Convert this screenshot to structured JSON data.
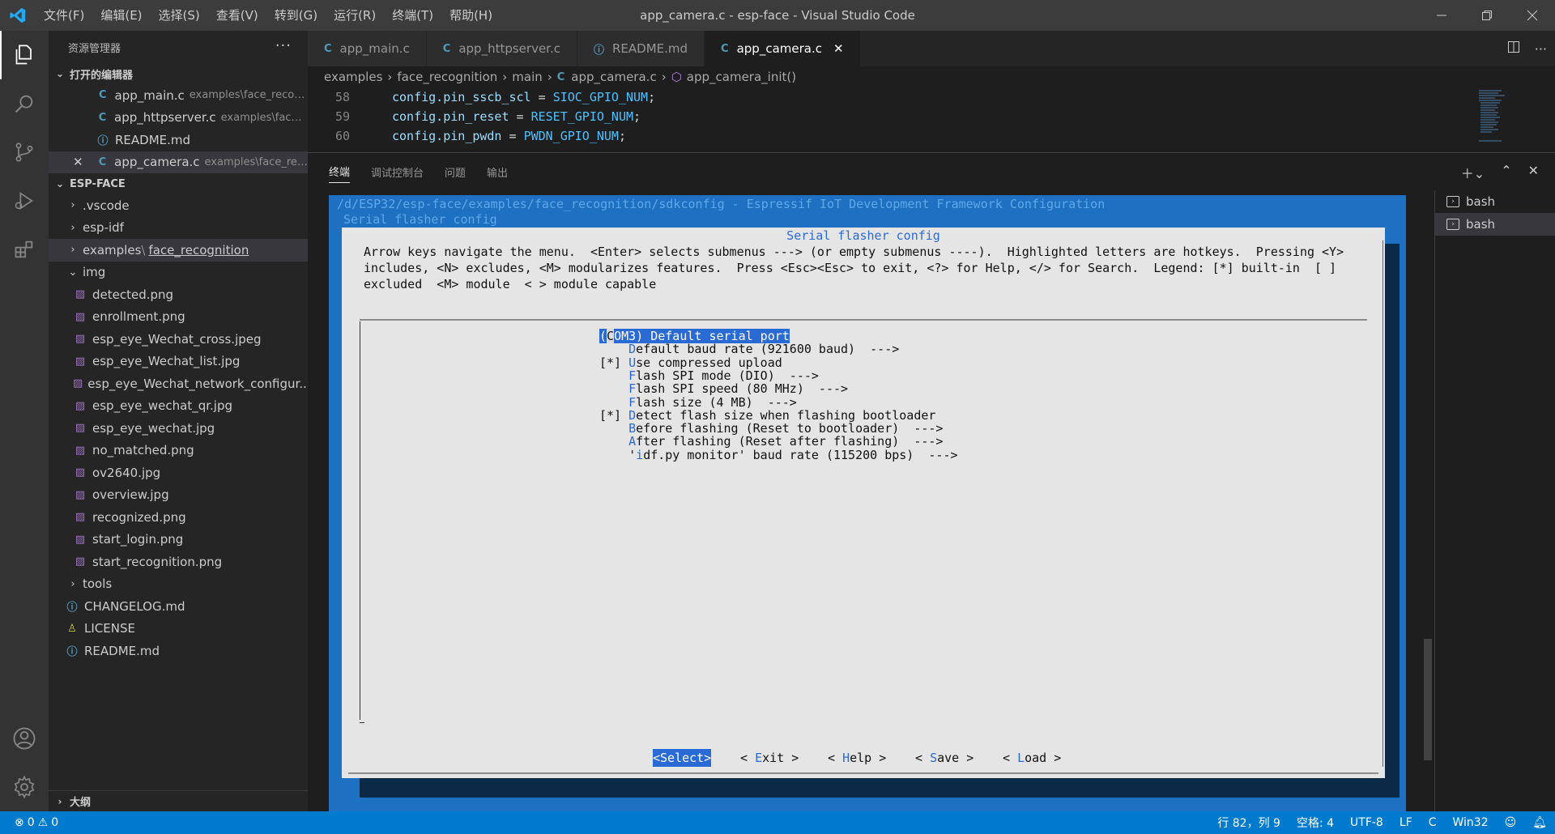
{
  "window": {
    "title": "app_camera.c - esp-face - Visual Studio Code",
    "menu": [
      "文件(F)",
      "编辑(E)",
      "选择(S)",
      "查看(V)",
      "转到(G)",
      "运行(R)",
      "终端(T)",
      "帮助(H)"
    ]
  },
  "sidebar": {
    "header": "资源管理器",
    "open_editors_title": "打开的编辑器",
    "open_editors": [
      {
        "name": "app_main.c",
        "desc": "examples\\face_recog...",
        "icon": "c-file-icon"
      },
      {
        "name": "app_httpserver.c",
        "desc": "examples\\face_...",
        "icon": "c-file-icon"
      },
      {
        "name": "README.md",
        "desc": "",
        "icon": "info-icon"
      },
      {
        "name": "app_camera.c",
        "desc": "examples\\face_rec...",
        "icon": "c-file-icon"
      }
    ],
    "project_title": "ESP-FACE",
    "tree": {
      "vscode": ".vscode",
      "espidf": "esp-idf",
      "examples_a": "examples",
      "examples_sep": "\\",
      "examples_b": "face_recognition",
      "img": "img",
      "img_files": [
        "detected.png",
        "enrollment.png",
        "esp_eye_Wechat_cross.jpeg",
        "esp_eye_Wechat_list.jpg",
        "esp_eye_Wechat_network_configur...",
        "esp_eye_wechat_qr.jpg",
        "esp_eye_wechat.jpg",
        "no_matched.png",
        "ov2640.jpg",
        "overview.jpg",
        "recognized.png",
        "start_login.png",
        "start_recognition.png"
      ],
      "tools": "tools",
      "changelog": "CHANGELOG.md",
      "license": "LICENSE",
      "readme": "README.md"
    },
    "outline": "大纲"
  },
  "tabs": [
    {
      "label": "app_main.c",
      "icon": "C"
    },
    {
      "label": "app_httpserver.c",
      "icon": "C"
    },
    {
      "label": "README.md",
      "icon": "ⓘ"
    },
    {
      "label": "app_camera.c",
      "icon": "C"
    }
  ],
  "breadcrumb": {
    "a": "examples",
    "b": "face_recognition",
    "c": "main",
    "d": "app_camera.c",
    "e": "app_camera_init()"
  },
  "code": [
    {
      "ln": "58",
      "lhs": "config.pin_sscb_scl",
      "rhs": "SIOC_GPIO_NUM"
    },
    {
      "ln": "59",
      "lhs": "config.pin_reset",
      "rhs": "RESET_GPIO_NUM"
    },
    {
      "ln": "60",
      "lhs": "config.pin_pwdn",
      "rhs": "PWDN_GPIO_NUM"
    }
  ],
  "panel": {
    "tabs": [
      "终端",
      "调试控制台",
      "问题",
      "输出"
    ],
    "terminals": [
      "bash",
      "bash"
    ]
  },
  "menuconfig": {
    "path_line": "/d/ESP32/esp-face/examples/face_recognition/sdkconfig - Espressif IoT Development Framework Configuration",
    "section_line": "Serial flasher config",
    "dialog_title": "Serial flasher config",
    "help_text": "Arrow keys navigate the menu.  <Enter> selects submenus ---> (or empty submenus ----).  Highlighted letters are hotkeys.  Pressing <Y>\nincludes, <N> excludes, <M> modularizes features.  Press <Esc><Esc> to exit, <?> for Help, </> for Search.  Legend: [*] built-in  [ ]\nexcluded  <M> module  < > module capable",
    "items": [
      {
        "pre": "(",
        "cur": "C",
        "text": "OM3) Default serial port"
      },
      {
        "pre": "    ",
        "hk": "D",
        "text": "efault baud rate (921600 baud)  --->"
      },
      {
        "pre": "[*] ",
        "hk": "U",
        "text": "se compressed upload"
      },
      {
        "pre": "    ",
        "hk": "F",
        "text": "lash SPI mode (DIO)  --->"
      },
      {
        "pre": "    ",
        "hk": "F",
        "text": "lash SPI speed (80 MHz)  --->"
      },
      {
        "pre": "    ",
        "hk": "F",
        "text": "lash size (4 MB)  --->"
      },
      {
        "pre": "[*] ",
        "hk": "D",
        "text": "etect flash size when flashing bootloader"
      },
      {
        "pre": "    ",
        "hk": "B",
        "text": "efore flashing (Reset to bootloader)  --->"
      },
      {
        "pre": "    ",
        "hk": "A",
        "text": "fter flashing (Reset after flashing)  --->"
      },
      {
        "pre": "    '",
        "hk": "i",
        "text": "df.py monitor' baud rate (115200 bps)  --->"
      }
    ],
    "buttons": {
      "select": "<Select>",
      "exit_pre": "< ",
      "exit_hk": "E",
      "exit_rest": "xit >",
      "help_pre": "< ",
      "help_hk": "H",
      "help_rest": "elp >",
      "save_pre": "< ",
      "save_hk": "S",
      "save_rest": "ave >",
      "load_pre": "< ",
      "load_hk": "L",
      "load_rest": "oad >"
    }
  },
  "statusbar": {
    "errors": "0",
    "warnings": "0",
    "position": "行 82，列 9",
    "spaces": "空格: 4",
    "encoding": "UTF-8",
    "eol": "LF",
    "language": "C",
    "platform": "Win32"
  },
  "colors": {
    "accent": "#007acc",
    "menuconfig_blue": "#1e70c2",
    "highlight": "#2a6ad5"
  }
}
